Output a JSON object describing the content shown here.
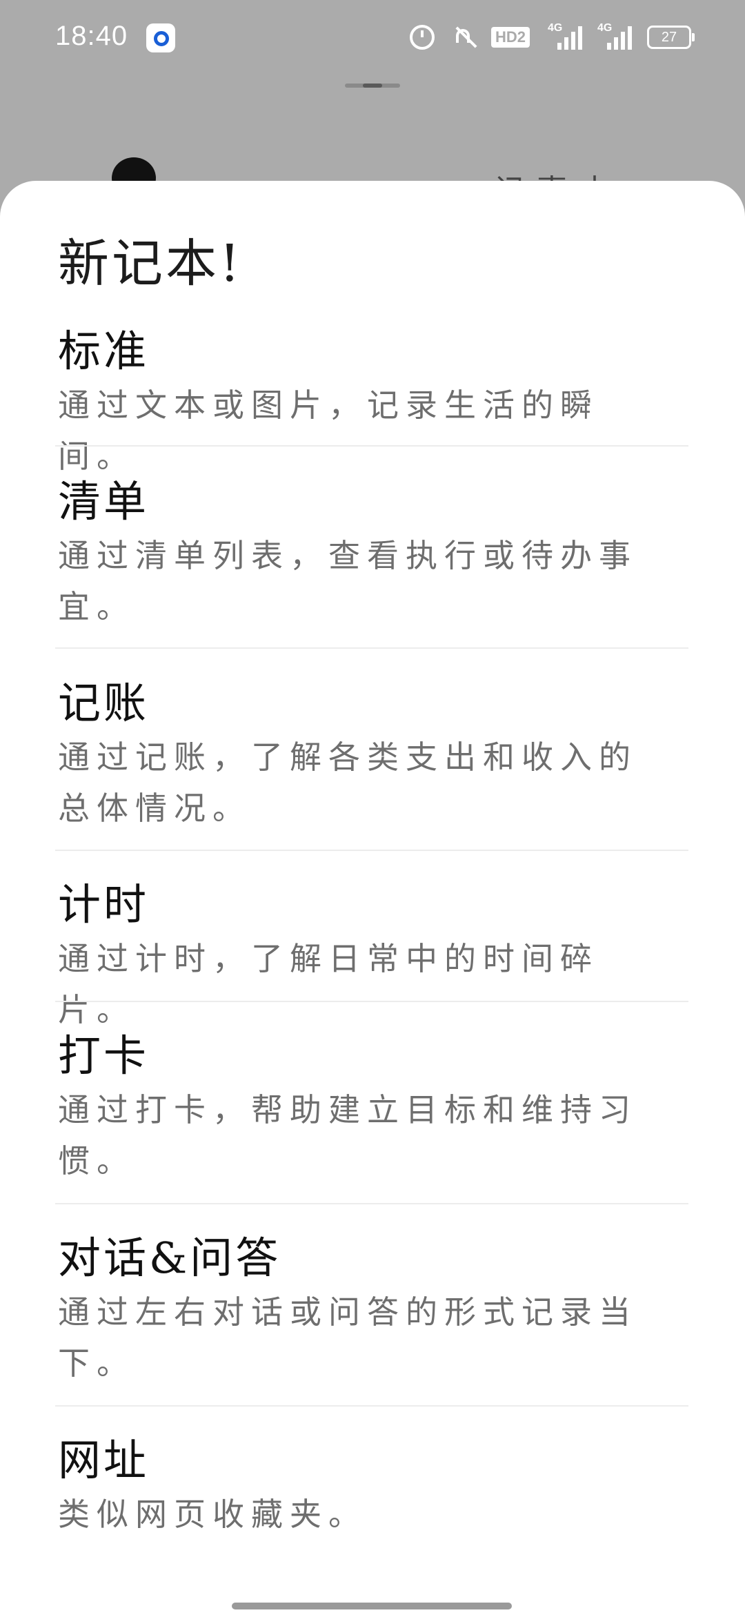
{
  "status_bar": {
    "time": "18:40",
    "hd_label": "HD2",
    "signal1_label": "4G",
    "signal2_label": "4G",
    "battery": "27",
    "icons": [
      "app-badge-icon",
      "alarm-icon",
      "bell-muted-icon",
      "hd-voice-icon",
      "signal-4g-icon",
      "signal-4g-icon",
      "battery-icon"
    ]
  },
  "background": {
    "scribble_text": "记事本"
  },
  "sheet": {
    "title": "新记本!",
    "items": [
      {
        "title": "标准",
        "description": "通过文本或图片，记录生活的瞬间。"
      },
      {
        "title": "清单",
        "description": "通过清单列表，查看执行或待办事宜。"
      },
      {
        "title": "记账",
        "description": "通过记账，了解各类支出和收入的总体情况。"
      },
      {
        "title": "计时",
        "description": "通过计时，了解日常中的时间碎片。"
      },
      {
        "title": "打卡",
        "description": "通过打卡，帮助建立目标和维持习惯。"
      },
      {
        "title": "对话&问答",
        "description": "通过左右对话或问答的形式记录当下。"
      },
      {
        "title": "网址",
        "description": "类似网页收藏夹。"
      }
    ]
  },
  "colors": {
    "sheet_background": "#ffffff",
    "scrim": "#ababab",
    "title_text": "#111111",
    "description_text": "#6e6e6e",
    "divider": "#ececec"
  }
}
